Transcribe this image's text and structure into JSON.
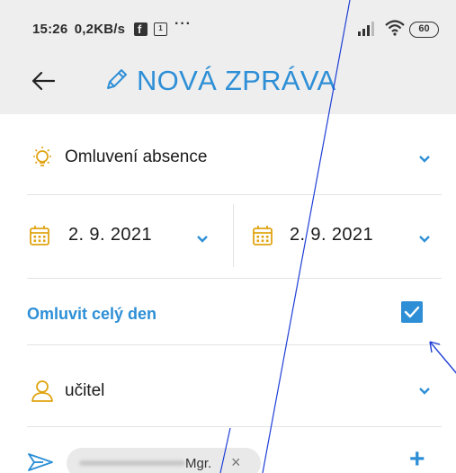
{
  "status_bar": {
    "time": "15:26",
    "speed": "0,2KB/s",
    "more": "···",
    "calendar_badge": "1",
    "battery": "60"
  },
  "header": {
    "title": "NOVÁ ZPRÁVA",
    "icons": {
      "back": "arrow-left-icon",
      "edit": "pencil-icon"
    }
  },
  "form": {
    "reason": {
      "label": "Omluvení absence",
      "icon": "lightbulb-icon"
    },
    "date_from": {
      "value": "2. 9. 2021",
      "icon": "calendar-icon"
    },
    "date_to": {
      "value": "2. 9. 2021",
      "icon": "calendar-icon"
    },
    "full_day": {
      "label": "Omluvit celý den",
      "checked": true
    },
    "recipient_type": {
      "label": "učitel",
      "icon": "person-icon"
    },
    "recipient": {
      "chip_name": "Mgr.",
      "remove": "×",
      "add": "+"
    }
  },
  "colors": {
    "accent": "#2e8fd6",
    "header_bg": "#eeeeee",
    "annotation_line": "#1e3fd6"
  }
}
